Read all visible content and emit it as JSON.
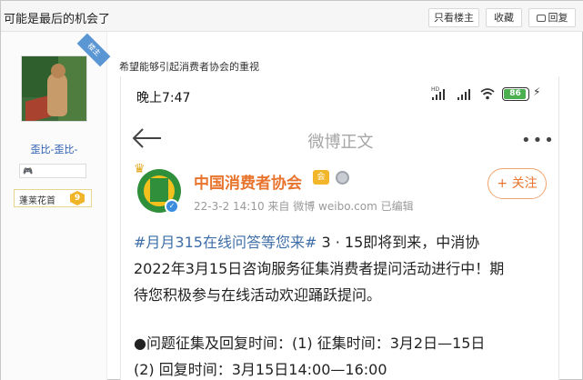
{
  "topbar": {
    "title": "可能是最后的机会了",
    "only_host_label": "只看楼主",
    "favorite_label": "收藏",
    "reply_label": "回复"
  },
  "user": {
    "host_tag": "楼主",
    "name": "歪比-歪比-",
    "level_name": "蓬莱花首",
    "level_num": "9"
  },
  "post": {
    "caption": "希望能够引起消费者协会的重视"
  },
  "phone": {
    "time": "晚上7:47",
    "hd_label": "HD",
    "battery": "86",
    "nav_title": "微博正文",
    "more": "•••"
  },
  "weibo": {
    "org_name": "中国消费者协会",
    "vip_badge": "会",
    "meta": "22-3-2 14:10  来自 微博 weibo.com  已编辑",
    "follow_label": "+ 关注",
    "hashtag": "#月月315在线问答等您来#",
    "text_line1_rest": " 3 · 15即将到来，中消协",
    "text_line2": "2022年3月15日咨询服务征集消费者提问活动进行中！期",
    "text_line3": "待您积极参与在线活动欢迎踊跃提问。",
    "para2_line1": "●问题征集及回复时间：(1) 征集时间：3月2日—15日",
    "para2_line2": "(2) 回复时间：3月15日14:00—16:00"
  },
  "colors": {
    "accent_orange": "#e8742e",
    "hashtag_blue": "#3e6ea8",
    "username_blue": "#2a5db0",
    "host_tag_blue": "#5a96d4"
  }
}
